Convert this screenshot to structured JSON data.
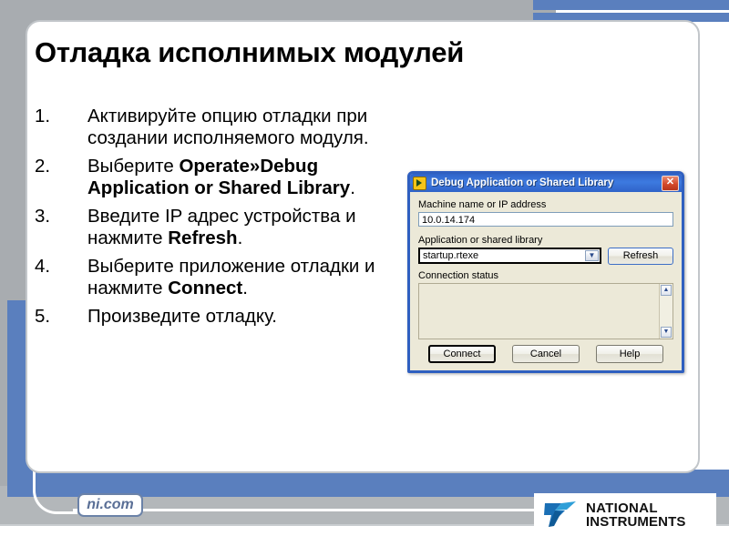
{
  "slide": {
    "title": "Отладка исполнимых модулей",
    "steps": [
      {
        "number": "1.",
        "parts": [
          {
            "text": "Активируйте опцию отладки при создании исполняемого модуля.",
            "bold": false
          }
        ]
      },
      {
        "number": "2.",
        "parts": [
          {
            "text": "Выберите ",
            "bold": false
          },
          {
            "text": "Operate»Debug Application or Shared Library",
            "bold": true
          },
          {
            "text": ".",
            "bold": false
          }
        ]
      },
      {
        "number": "3.",
        "parts": [
          {
            "text": "Введите IP адрес устройства и нажмите ",
            "bold": false
          },
          {
            "text": "Refresh",
            "bold": true
          },
          {
            "text": ".",
            "bold": false
          }
        ]
      },
      {
        "number": "4.",
        "parts": [
          {
            "text": "Выберите приложение отладки и нажмите ",
            "bold": false
          },
          {
            "text": "Connect",
            "bold": true
          },
          {
            "text": ".",
            "bold": false
          }
        ]
      },
      {
        "number": "5.",
        "parts": [
          {
            "text": "Произведите отладку.",
            "bold": false
          }
        ]
      }
    ]
  },
  "dialog": {
    "title": "Debug Application or Shared Library",
    "titlebar_icon": "labview-vi-icon",
    "close_label": "✕",
    "close_icon": "close-icon",
    "machine_label": "Machine name or IP address",
    "machine_value": "10.0.14.174",
    "machine_placeholder": "",
    "app_label": "Application or shared library",
    "app_value": "startup.rtexe",
    "app_dropdown_icon": "chevron-down-icon",
    "refresh_label": "Refresh",
    "status_label": "Connection status",
    "status_value": "",
    "scroll_up_icon": "▲",
    "scroll_down_icon": "▼",
    "connect_label": "Connect",
    "cancel_label": "Cancel",
    "help_label": "Help"
  },
  "footer": {
    "nicom_label": "ni.com",
    "logo_line1": "NATIONAL",
    "logo_line2": "INSTRUMENTS",
    "logo_mark_icon": "ni-eagle-icon"
  },
  "colors": {
    "accent_blue": "#5a7fbe",
    "background_gray": "#a8acb0",
    "dialog_titlebar": "#3d7ae0",
    "dialog_face": "#ece9d8",
    "close_red": "#d4492a",
    "logo_blue": "#1a6fb5"
  }
}
